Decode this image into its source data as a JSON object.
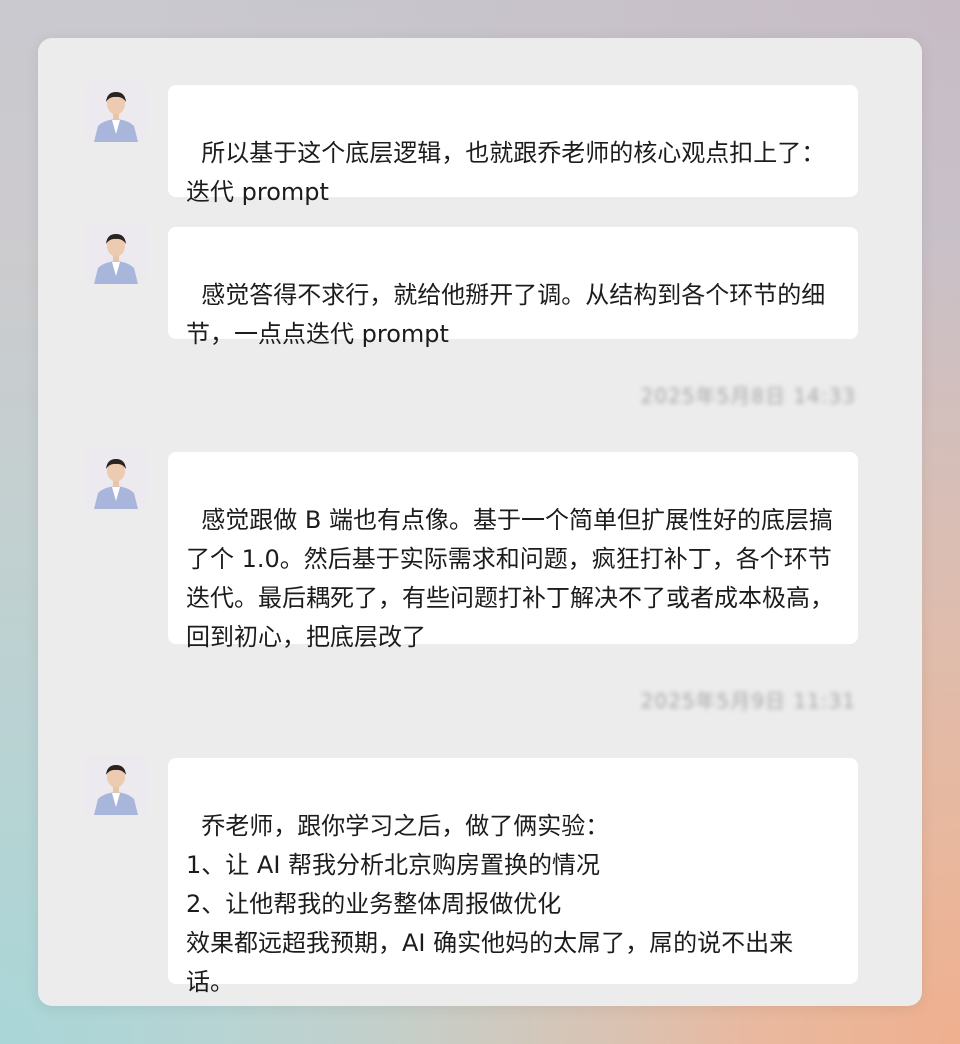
{
  "messages": [
    {
      "text": "所以基于这个底层逻辑，也就跟乔老师的核心观点扣上了：迭代 prompt"
    },
    {
      "text": "感觉答得不求行，就给他掰开了调。从结构到各个环节的细节，一点点迭代 prompt"
    },
    {
      "text": "感觉跟做 B 端也有点像。基于一个简单但扩展性好的底层搞了个 1.0。然后基于实际需求和问题，疯狂打补丁，各个环节迭代。最后耦死了，有些问题打补丁解决不了或者成本极高，回到初心，把底层改了"
    },
    {
      "text": "乔老师，跟你学习之后，做了俩实验：\n1、让 AI 帮我分析北京购房置换的情况\n2、让他帮我的业务整体周报做优化\n效果都远超我预期，AI 确实他妈的太屌了，屌的说不出来话。"
    }
  ],
  "timestamps": [
    "2025年5月8日 14:33",
    "2025年5月9日 11:31"
  ],
  "colors": {
    "panel": "#ececec",
    "bubble": "#ffffff",
    "text": "#1c1c1c",
    "timestamp": "#a7a7a7",
    "avatar_suit": "#a9b6dc"
  },
  "icons": {
    "avatar": "user-avatar-icon"
  }
}
